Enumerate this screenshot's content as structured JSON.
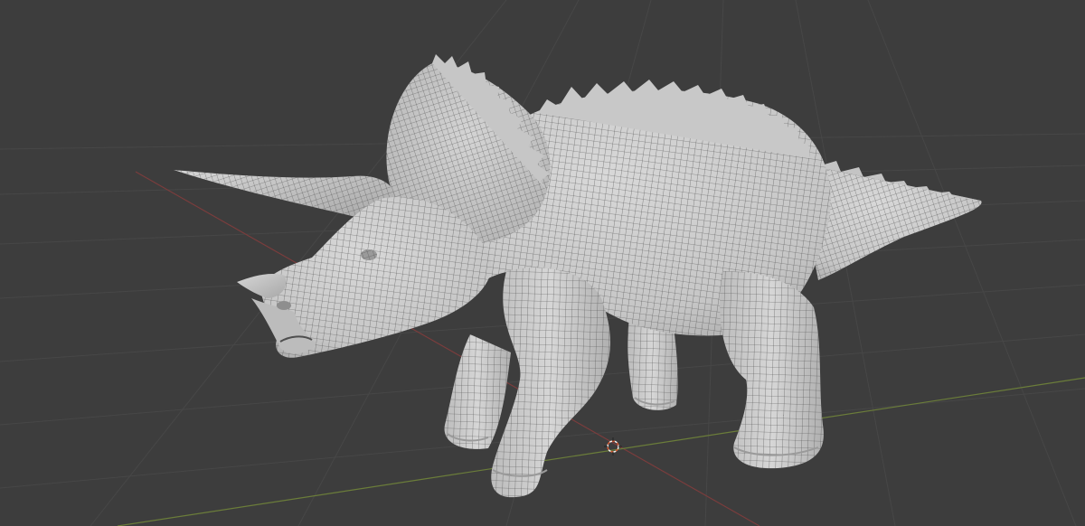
{
  "viewport": {
    "background_color": "#3d3d3d",
    "grid_line_color": "#474747",
    "x_axis_color": "#7a3d3d",
    "y_axis_color": "#6b7d3a",
    "cursor_colors": [
      "#d85a32",
      "#f2f2f2"
    ]
  },
  "model": {
    "object": "triceratops",
    "display": "wireframe-on-solid",
    "surface_color": "#cfcfcf",
    "wire_color": "#4e4e4e"
  }
}
